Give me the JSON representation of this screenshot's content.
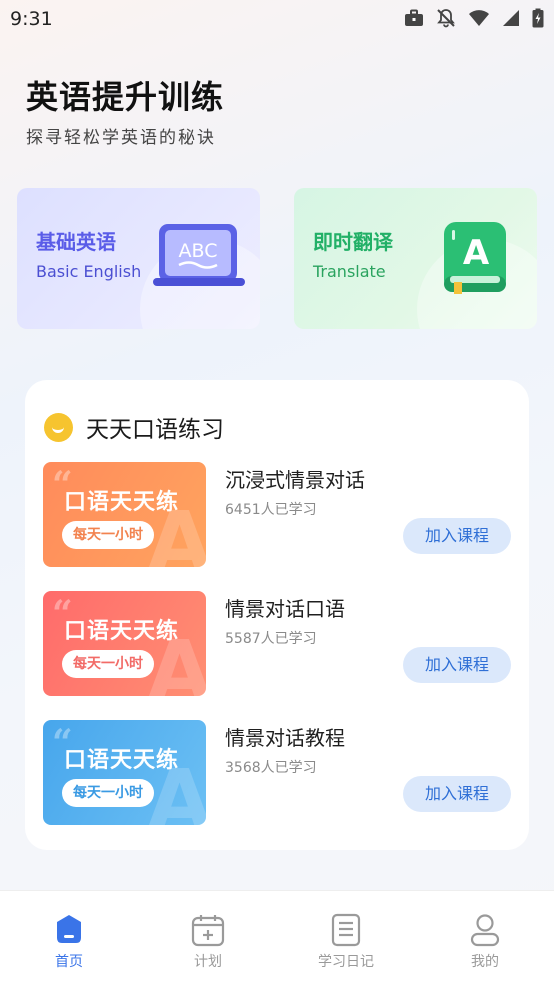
{
  "status_bar": {
    "time": "9:31"
  },
  "hero": {
    "title": "英语提升训练",
    "subtitle": "探寻轻松学英语的秘诀"
  },
  "features": [
    {
      "title": "基础英语",
      "subtitle": "Basic English",
      "icon": "abc-laptop-icon",
      "accent": "#5a5ce8"
    },
    {
      "title": "即时翻译",
      "subtitle": "Translate",
      "icon": "book-letter-a-icon",
      "accent": "#22b067"
    }
  ],
  "section": {
    "title": "天天口语练习",
    "icon": "smile-bubble-icon"
  },
  "courses": [
    {
      "thumb_title": "口语天天练",
      "thumb_pill": "每天一小时",
      "name": "沉浸式情景对话",
      "count": "6451人已学习",
      "join": "加入课程",
      "color": "#ff8b5b"
    },
    {
      "thumb_title": "口语天天练",
      "thumb_pill": "每天一小时",
      "name": "情景对话口语",
      "count": "5587人已学习",
      "join": "加入课程",
      "color": "#ff6b6b"
    },
    {
      "thumb_title": "口语天天练",
      "thumb_pill": "每天一小时",
      "name": "情景对话教程",
      "count": "3568人已学习",
      "join": "加入课程",
      "color": "#47a6ec"
    }
  ],
  "tabs": [
    {
      "label": "首页",
      "icon": "home-icon",
      "active": true
    },
    {
      "label": "计划",
      "icon": "calendar-icon",
      "active": false
    },
    {
      "label": "学习日记",
      "icon": "notebook-icon",
      "active": false
    },
    {
      "label": "我的",
      "icon": "profile-icon",
      "active": false
    }
  ],
  "colors": {
    "accent_blue": "#3a74e8",
    "join_bg": "#dbe8fb"
  }
}
